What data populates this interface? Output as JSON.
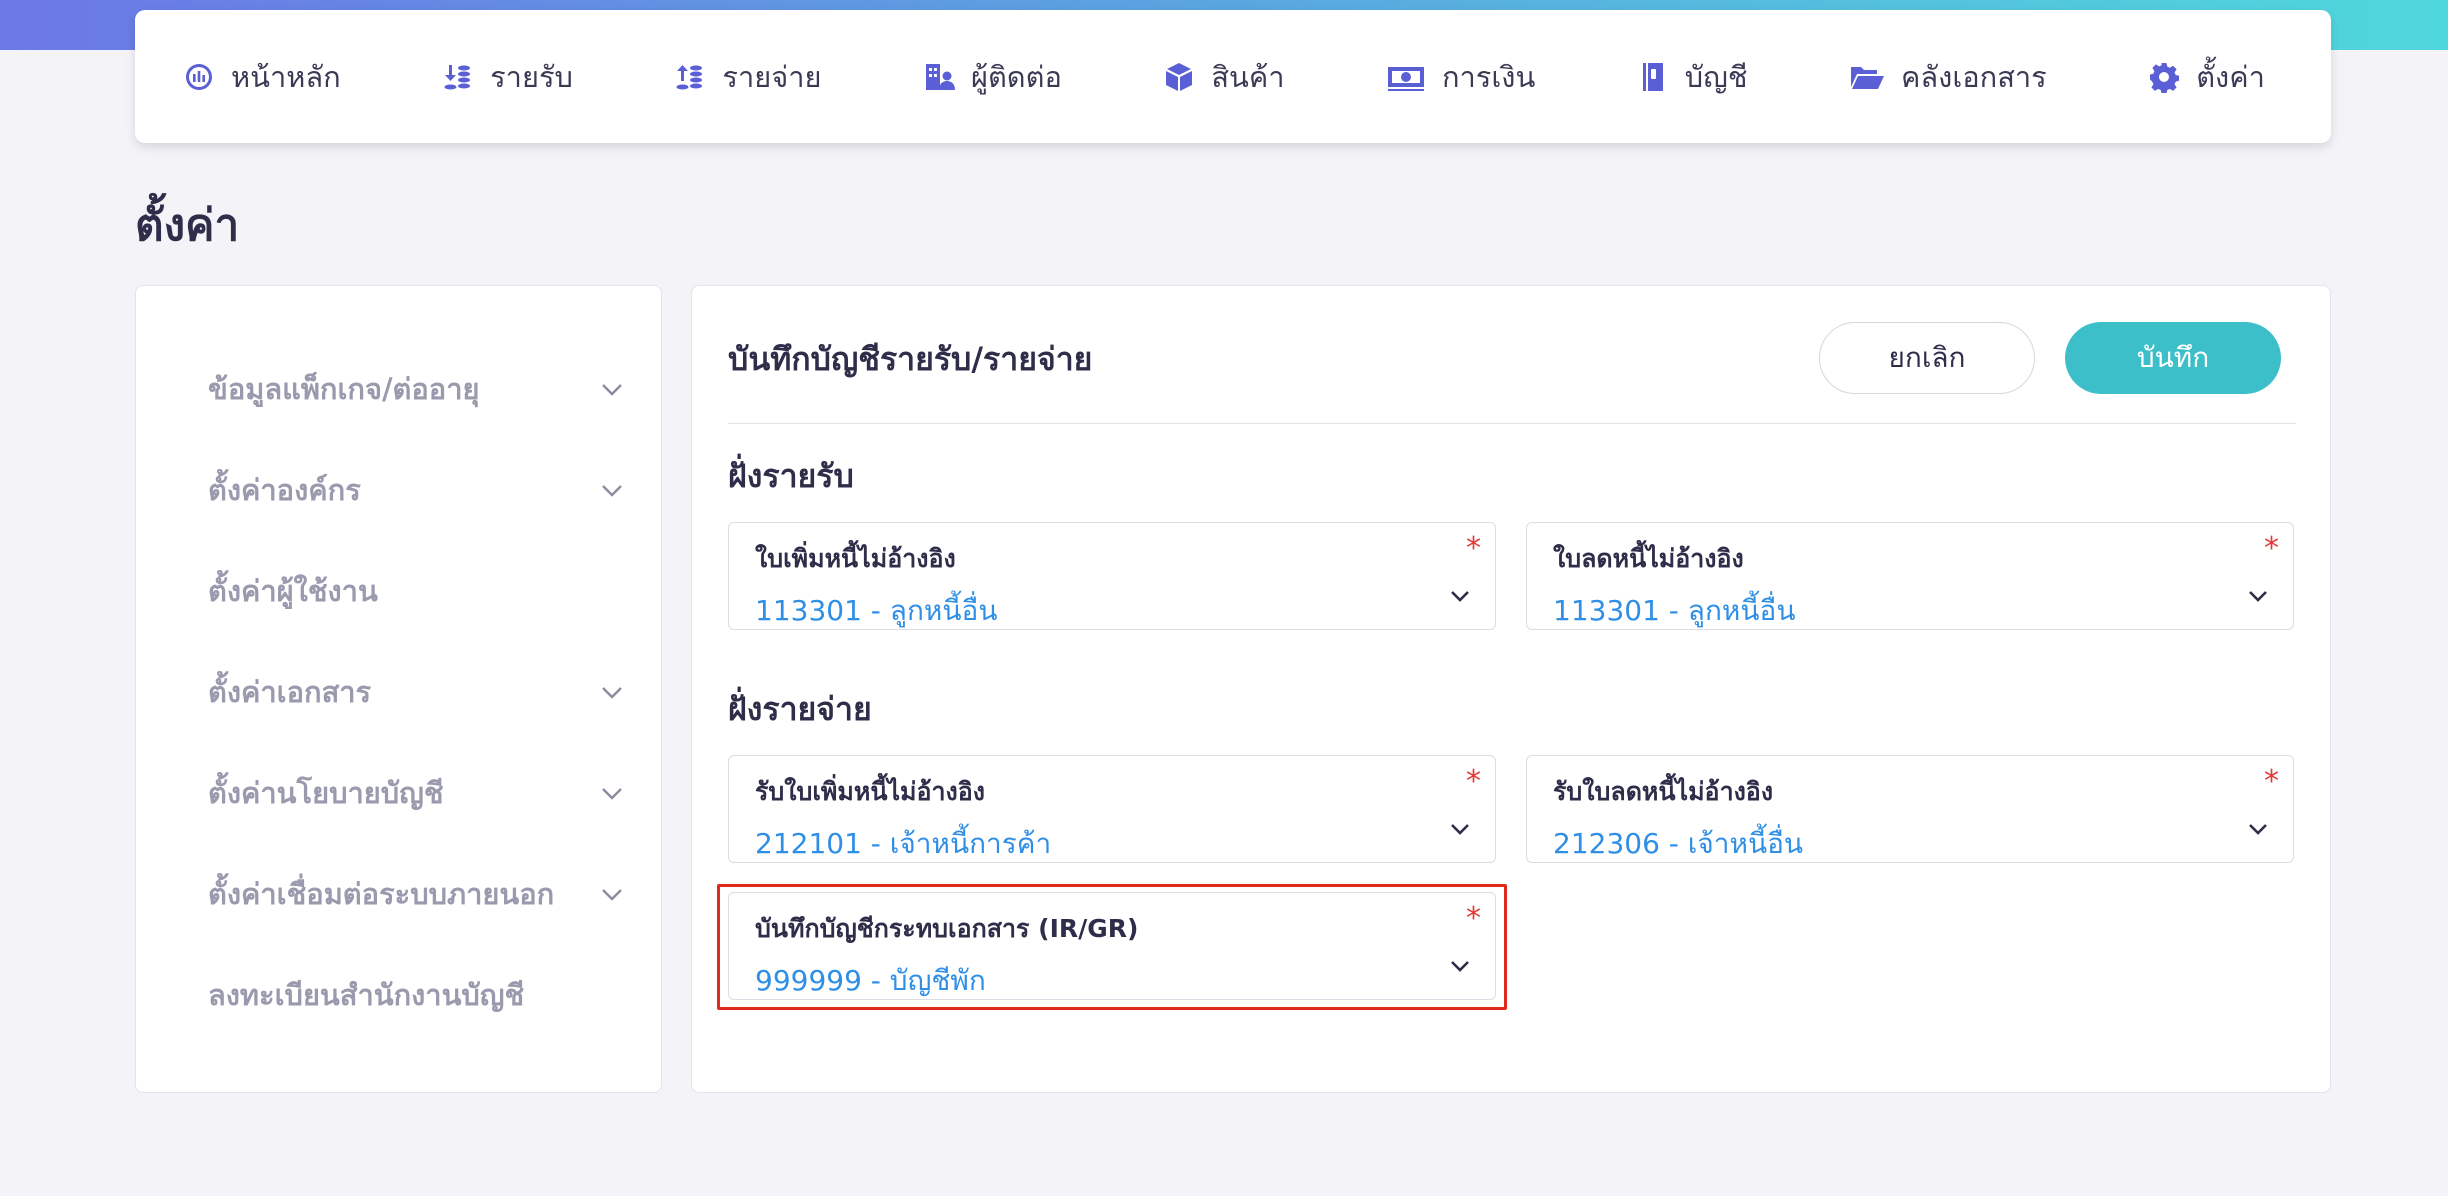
{
  "nav": {
    "items": [
      {
        "label": "หน้าหลัก",
        "icon": "dashboard-icon"
      },
      {
        "label": "รายรับ",
        "icon": "income-icon"
      },
      {
        "label": "รายจ่าย",
        "icon": "expense-icon"
      },
      {
        "label": "ผู้ติดต่อ",
        "icon": "contacts-icon"
      },
      {
        "label": "สินค้า",
        "icon": "product-box-icon"
      },
      {
        "label": "การเงิน",
        "icon": "money-icon"
      },
      {
        "label": "บัญชี",
        "icon": "ledger-book-icon"
      },
      {
        "label": "คลังเอกสาร",
        "icon": "folder-open-icon"
      },
      {
        "label": "ตั้งค่า",
        "icon": "gear-icon"
      }
    ]
  },
  "page": {
    "title": "ตั้งค่า"
  },
  "sidebar": {
    "items": [
      {
        "label": "ข้อมูลแพ็กเกจ/ต่ออายุ",
        "expandable": true
      },
      {
        "label": "ตั้งค่าองค์กร",
        "expandable": true
      },
      {
        "label": "ตั้งค่าผู้ใช้งาน",
        "expandable": false
      },
      {
        "label": "ตั้งค่าเอกสาร",
        "expandable": true
      },
      {
        "label": "ตั้งค่านโยบายบัญชี",
        "expandable": true
      },
      {
        "label": "ตั้งค่าเชื่อมต่อระบบภายนอก",
        "expandable": true
      },
      {
        "label": "ลงทะเบียนสำนักงานบัญชี",
        "expandable": false
      }
    ]
  },
  "panel": {
    "title": "บันทึกบัญชีรายรับ/รายจ่าย",
    "cancel_label": "ยกเลิก",
    "save_label": "บันทึก",
    "income": {
      "title": "ฝั่งรายรับ",
      "fields": [
        {
          "label": "ใบเพิ่มหนี้ไม่อ้างอิง",
          "value": "113301 - ลูกหนี้อื่น",
          "required": "*"
        },
        {
          "label": "ใบลดหนี้ไม่อ้างอิง",
          "value": "113301 - ลูกหนี้อื่น",
          "required": "*"
        }
      ]
    },
    "expense": {
      "title": "ฝั่งรายจ่าย",
      "fields": [
        {
          "label": "รับใบเพิ่มหนี้ไม่อ้างอิง",
          "value": "212101 - เจ้าหนี้การค้า",
          "required": "*"
        },
        {
          "label": "รับใบลดหนี้ไม่อ้างอิง",
          "value": "212306 - เจ้าหนี้อื่น",
          "required": "*"
        },
        {
          "label": "บันทึกบัญชีกระทบเอกสาร (IR/GR)",
          "value": "999999 - บัญชีพัก",
          "required": "*"
        }
      ]
    }
  },
  "colors": {
    "accent": "#5b5fd6",
    "save_button": "#3dbfc9",
    "value_text": "#2f8fe6",
    "required": "#e53935",
    "highlight_border": "#e0281c"
  }
}
